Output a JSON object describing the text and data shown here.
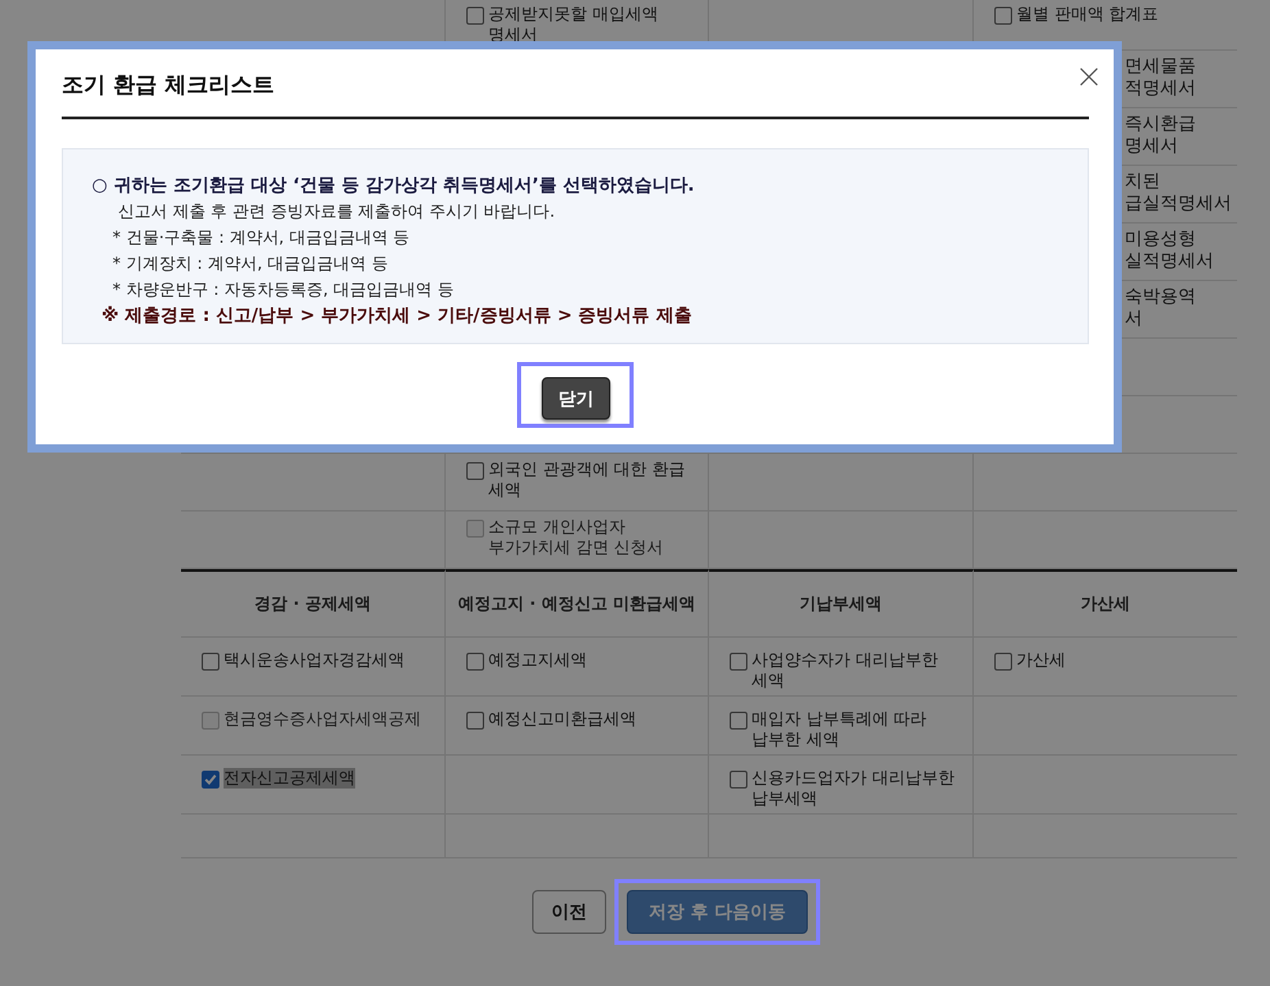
{
  "background_table": {
    "upper_rows": [
      [
        {
          "kind": "empty"
        },
        {
          "kind": "checkbox",
          "label": "공제받지못할 매입세액 명세서",
          "checked": false,
          "disabled": false
        },
        {
          "kind": "empty"
        },
        {
          "kind": "checkbox",
          "label": "월별 판매액 합계표",
          "checked": false,
          "disabled": false
        }
      ],
      [
        {
          "kind": "empty"
        },
        {
          "kind": "empty"
        },
        {
          "kind": "empty"
        },
        {
          "kind": "fragment",
          "lines": [
            "면세물품",
            "적명세서"
          ]
        }
      ],
      [
        {
          "kind": "empty"
        },
        {
          "kind": "empty"
        },
        {
          "kind": "empty"
        },
        {
          "kind": "fragment",
          "lines": [
            "즉시환급",
            "명세서"
          ]
        }
      ],
      [
        {
          "kind": "empty"
        },
        {
          "kind": "empty"
        },
        {
          "kind": "empty"
        },
        {
          "kind": "fragment",
          "lines": [
            "치된",
            "급실적명세서"
          ]
        }
      ],
      [
        {
          "kind": "empty"
        },
        {
          "kind": "empty"
        },
        {
          "kind": "empty"
        },
        {
          "kind": "fragment",
          "lines": [
            "미용성형",
            "실적명세서"
          ]
        }
      ],
      [
        {
          "kind": "empty"
        },
        {
          "kind": "empty"
        },
        {
          "kind": "empty"
        },
        {
          "kind": "fragment",
          "lines": [
            "숙박용역",
            "서"
          ]
        }
      ],
      [
        {
          "kind": "empty"
        },
        {
          "kind": "empty"
        },
        {
          "kind": "empty"
        },
        {
          "kind": "empty"
        }
      ],
      [
        {
          "kind": "empty"
        },
        {
          "kind": "empty"
        },
        {
          "kind": "empty"
        },
        {
          "kind": "empty"
        }
      ],
      [
        {
          "kind": "empty"
        },
        {
          "kind": "checkbox",
          "label": "외국인 관광객에 대한 환급 세액",
          "checked": false,
          "disabled": false
        },
        {
          "kind": "empty"
        },
        {
          "kind": "empty"
        }
      ],
      [
        {
          "kind": "empty"
        },
        {
          "kind": "checkbox",
          "label": "소규모 개인사업자 부가가치세 감면 신청서",
          "checked": false,
          "disabled": true
        },
        {
          "kind": "empty"
        },
        {
          "kind": "empty"
        }
      ]
    ],
    "headers": [
      "경감 · 공제세액",
      "예정고지 · 예정신고 미환급세액",
      "기납부세액",
      "가산세"
    ],
    "rows": [
      [
        {
          "kind": "checkbox",
          "label": "택시운송사업자경감세액",
          "checked": false,
          "disabled": false
        },
        {
          "kind": "checkbox",
          "label": "예정고지세액",
          "checked": false,
          "disabled": false
        },
        {
          "kind": "checkbox",
          "label": "사업양수자가 대리납부한 세액",
          "checked": false,
          "disabled": false
        },
        {
          "kind": "checkbox",
          "label": "가산세",
          "checked": false,
          "disabled": false
        }
      ],
      [
        {
          "kind": "checkbox",
          "label": "현금영수증사업자세액공제",
          "checked": false,
          "disabled": true
        },
        {
          "kind": "checkbox",
          "label": "예정신고미환급세액",
          "checked": false,
          "disabled": false
        },
        {
          "kind": "checkbox",
          "label": "매입자 납부특례에 따라 납부한 세액",
          "checked": false,
          "disabled": false
        },
        {
          "kind": "empty"
        }
      ],
      [
        {
          "kind": "checkbox",
          "label": "전자신고공제세액",
          "checked": true,
          "disabled": false,
          "highlighted": true
        },
        {
          "kind": "empty"
        },
        {
          "kind": "checkbox",
          "label": "신용카드업자가 대리납부한 납부세액",
          "checked": false,
          "disabled": false
        },
        {
          "kind": "empty"
        }
      ],
      [
        {
          "kind": "empty"
        },
        {
          "kind": "empty"
        },
        {
          "kind": "empty"
        },
        {
          "kind": "empty"
        }
      ]
    ]
  },
  "buttons": [
    {
      "label": "이전",
      "kind": "secondary",
      "highlighted": false
    },
    {
      "label": "저장 후 다음이동",
      "kind": "primary",
      "highlighted": true
    }
  ],
  "dialog": {
    "title": "조기 환급 체크리스트",
    "message": [
      {
        "kind": "heading",
        "text": "○ 귀하는 조기환급 대상 ‘건물 등 감가상각 취득명세서’를 선택하였습니다."
      },
      {
        "kind": "note",
        "text": "신고서 제출 후 관련 증빙자료를 제출하여 주시기 바랍니다."
      },
      {
        "kind": "item",
        "text": "* 건물·구축물 : 계약서, 대금입금내역 등"
      },
      {
        "kind": "item",
        "text": "* 기계장치 : 계약서, 대금입금내역 등"
      },
      {
        "kind": "item",
        "text": "* 차량운반구 : 자동차등록증, 대금입금내역 등"
      },
      {
        "kind": "path",
        "text": "※ 제출경로 : 신고/납부 > 부가가치세 > 기타/증빙서류 > 증빙서류 제출"
      }
    ],
    "button": {
      "label": "닫기",
      "highlighted": true
    }
  }
}
